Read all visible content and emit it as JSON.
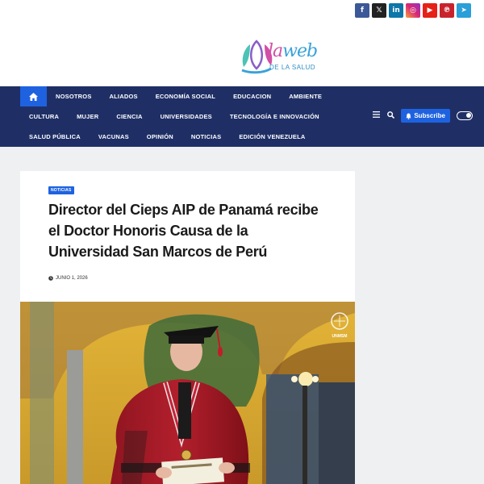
{
  "social": {
    "icons": [
      "facebook-icon",
      "x-icon",
      "linkedin-icon",
      "instagram-icon",
      "youtube-icon",
      "pinterest-icon",
      "telegram-icon"
    ],
    "glyphs": [
      "f",
      "𝕏",
      "in",
      "◎",
      "▶",
      "℗",
      "➤"
    ]
  },
  "logo": {
    "word_la": "la",
    "word_web": "web",
    "subtitle": "DE LA SALUD"
  },
  "nav": {
    "row1": [
      "NOSOTROS",
      "ALIADOS",
      "ECONOMÍA SOCIAL",
      "EDUCACION",
      "AMBIENTE"
    ],
    "row2": [
      "CULTURA",
      "MUJER",
      "CIENCIA",
      "UNIVERSIDADES",
      "TECNOLOGÍA E INNOVACIÓN"
    ],
    "row3": [
      "SALUD PÚBLICA",
      "VACUNAS",
      "OPINIÓN",
      "NOTICIAS",
      "EDICIÓN VENEZUELA"
    ],
    "subscribe_label": "Subscribe"
  },
  "article": {
    "category": "NOTICIAS",
    "title": "Director del Cieps AIP de Panamá recibe el Doctor Honoris Causa de la Universidad San Marcos de Perú",
    "date": "JUNIO 1, 2026"
  },
  "photo": {
    "watermark": "UNMSM"
  },
  "colors": {
    "nav_bg": "#1f2f66",
    "accent": "#1e62e0"
  }
}
